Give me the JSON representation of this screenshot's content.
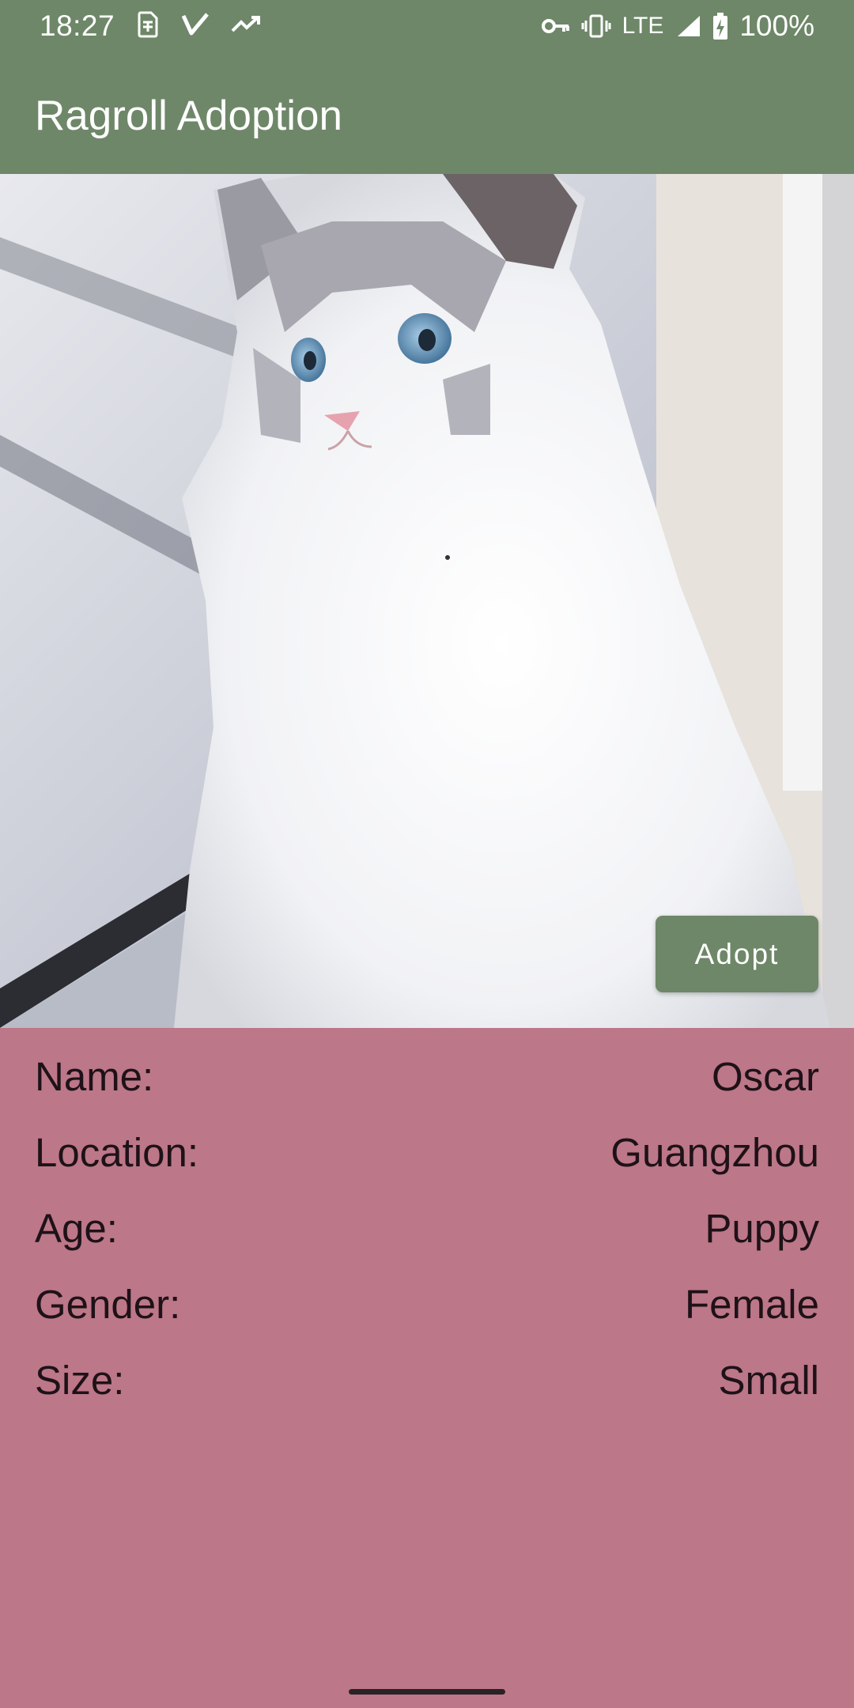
{
  "status_bar": {
    "time": "18:27",
    "network": "LTE",
    "battery": "100%",
    "left_icons": [
      "sim-icon",
      "check-v-icon",
      "trending-icon"
    ],
    "right_icons": [
      "vpn-key-icon",
      "vibrate-icon",
      "signal-icon",
      "battery-charging-icon"
    ]
  },
  "app_bar": {
    "title": "Ragroll Adoption",
    "color": "#6E8768"
  },
  "hero": {
    "subject": "ragdoll cat photo"
  },
  "adopt_button": {
    "label": "Adopt",
    "color": "#6E8768"
  },
  "details": {
    "background": "#BC7788",
    "rows": [
      {
        "label": "Name:",
        "value": "Oscar"
      },
      {
        "label": "Location:",
        "value": "Guangzhou"
      },
      {
        "label": "Age:",
        "value": "Puppy"
      },
      {
        "label": "Gender:",
        "value": "Female"
      },
      {
        "label": "Size:",
        "value": "Small"
      }
    ]
  }
}
